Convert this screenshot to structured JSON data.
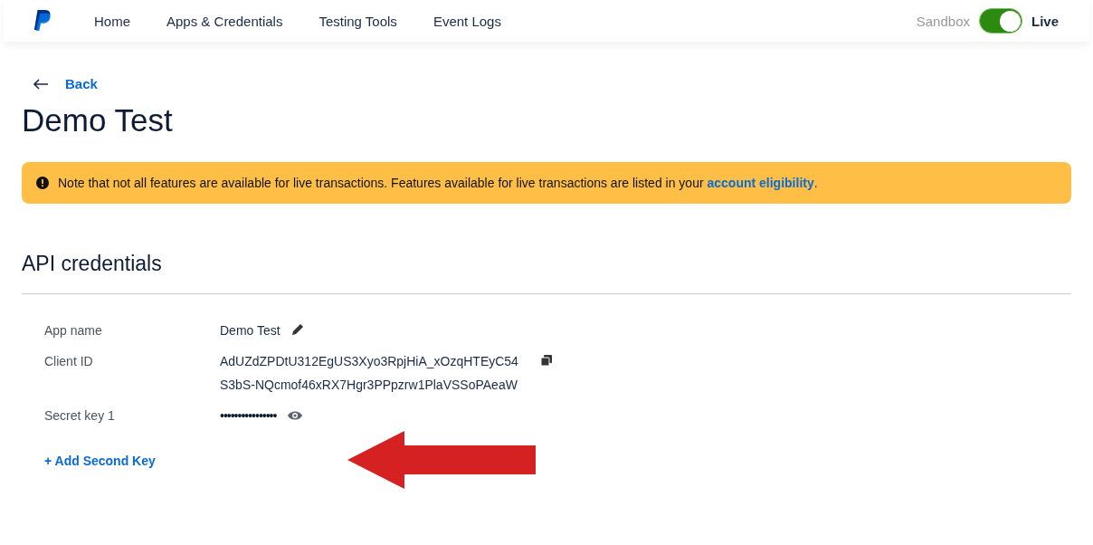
{
  "nav": {
    "items": [
      {
        "label": "Home",
        "selected": false
      },
      {
        "label": "Apps & Credentials",
        "selected": false
      },
      {
        "label": "Testing Tools",
        "selected": false
      },
      {
        "label": "Event Logs",
        "selected": false
      }
    ],
    "environment": {
      "left_label": "Sandbox",
      "right_label": "Live",
      "on": true
    }
  },
  "back_link": "Back",
  "title": "Demo Test",
  "notice": {
    "text": "Note that not all features are available for live transactions. Features available for live transactions are listed in your ",
    "link": "account eligibility",
    "end": "."
  },
  "section_title": "API credentials",
  "credentials": [
    {
      "kind": "editable",
      "label": "App name",
      "lines": [
        "Demo Test"
      ]
    },
    {
      "kind": "copyable",
      "label": "Client ID",
      "lines": [
        "AdUZdZPDtU312EgUS3Xyo3RpjHiA_xOzqHTEyC54",
        "S3bS-NQcmof46xRX7Hgr3PPpzrw1PlaVSSoPAeaW"
      ]
    },
    {
      "kind": "secret",
      "label": "Secret key 1",
      "lines": [
        "••••••••••••••••"
      ]
    }
  ],
  "add_key_link": "+ Add Second Key"
}
